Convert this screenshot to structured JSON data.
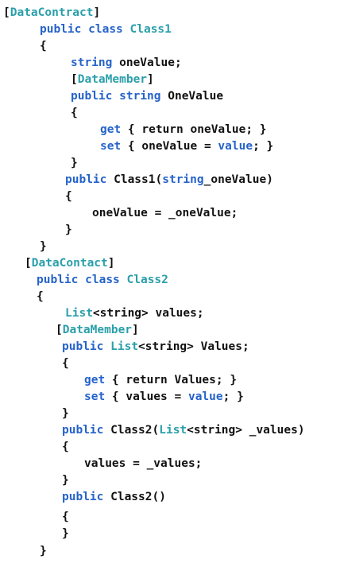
{
  "colors": {
    "keyword": "#2563c9",
    "type": "#2a9faa",
    "text": "#111111",
    "background": "#ffffff"
  },
  "lines": [
    {
      "tokens": [
        {
          "t": "[",
          "c": "plain"
        },
        {
          "t": "DataContract",
          "c": "attr"
        },
        {
          "t": "]",
          "c": "plain"
        }
      ]
    },
    {
      "tokens": [
        {
          "t": "public",
          "c": "kw"
        },
        {
          "t": " ",
          "c": "plain"
        },
        {
          "t": "class",
          "c": "kw"
        },
        {
          "t": " ",
          "c": "plain"
        },
        {
          "t": "Class1",
          "c": "type"
        }
      ]
    },
    {
      "tokens": [
        {
          "t": "{",
          "c": "plain"
        }
      ]
    },
    {
      "tokens": [
        {
          "t": "string",
          "c": "kw"
        },
        {
          "t": " oneValue;",
          "c": "plain"
        }
      ]
    },
    {
      "tokens": [
        {
          "t": "[",
          "c": "plain"
        },
        {
          "t": "DataMember",
          "c": "attr"
        },
        {
          "t": "]",
          "c": "plain"
        }
      ]
    },
    {
      "tokens": [
        {
          "t": "public",
          "c": "kw"
        },
        {
          "t": " ",
          "c": "plain"
        },
        {
          "t": "string",
          "c": "kw"
        },
        {
          "t": " OneValue",
          "c": "plain"
        }
      ]
    },
    {
      "tokens": [
        {
          "t": "{",
          "c": "plain"
        }
      ]
    },
    {
      "tokens": [
        {
          "t": "get",
          "c": "kw"
        },
        {
          "t": " { return oneValue; }",
          "c": "plain"
        }
      ]
    },
    {
      "tokens": [
        {
          "t": "set",
          "c": "kw"
        },
        {
          "t": " { oneValue = ",
          "c": "plain"
        },
        {
          "t": "value",
          "c": "kw"
        },
        {
          "t": "; }",
          "c": "plain"
        }
      ]
    },
    {
      "tokens": [
        {
          "t": "}",
          "c": "plain"
        }
      ]
    },
    {
      "tokens": [
        {
          "t": "public",
          "c": "kw"
        },
        {
          "t": " Class1(",
          "c": "plain"
        },
        {
          "t": "string",
          "c": "kw"
        },
        {
          "t": "_oneValue)",
          "c": "plain"
        }
      ]
    },
    {
      "tokens": [
        {
          "t": "{",
          "c": "plain"
        }
      ]
    },
    {
      "tokens": [
        {
          "t": "oneValue = _oneValue;",
          "c": "plain"
        }
      ]
    },
    {
      "tokens": [
        {
          "t": "}",
          "c": "plain"
        }
      ]
    },
    {
      "tokens": [
        {
          "t": "}",
          "c": "plain"
        }
      ]
    },
    {
      "tokens": [
        {
          "t": "[",
          "c": "plain"
        },
        {
          "t": "DataContact",
          "c": "attr"
        },
        {
          "t": "]",
          "c": "plain"
        }
      ]
    },
    {
      "tokens": [
        {
          "t": "public",
          "c": "kw"
        },
        {
          "t": " ",
          "c": "plain"
        },
        {
          "t": "class",
          "c": "kw"
        },
        {
          "t": " ",
          "c": "plain"
        },
        {
          "t": "Class2",
          "c": "type"
        }
      ]
    },
    {
      "tokens": [
        {
          "t": "{",
          "c": "plain"
        }
      ]
    },
    {
      "tokens": [
        {
          "t": "List",
          "c": "type"
        },
        {
          "t": "<string> values;",
          "c": "plain"
        }
      ]
    },
    {
      "tokens": [
        {
          "t": "[",
          "c": "plain"
        },
        {
          "t": "DataMember",
          "c": "attr"
        },
        {
          "t": "]",
          "c": "plain"
        }
      ]
    },
    {
      "tokens": [
        {
          "t": "public",
          "c": "kw"
        },
        {
          "t": " ",
          "c": "plain"
        },
        {
          "t": "List",
          "c": "type"
        },
        {
          "t": "<string> Values;",
          "c": "plain"
        }
      ]
    },
    {
      "tokens": [
        {
          "t": "{",
          "c": "plain"
        }
      ]
    },
    {
      "tokens": [
        {
          "t": "get",
          "c": "kw"
        },
        {
          "t": " { return Values; }",
          "c": "plain"
        }
      ]
    },
    {
      "tokens": [
        {
          "t": "set",
          "c": "kw"
        },
        {
          "t": " { values = ",
          "c": "plain"
        },
        {
          "t": "value",
          "c": "kw"
        },
        {
          "t": "; }",
          "c": "plain"
        }
      ]
    },
    {
      "tokens": [
        {
          "t": "}",
          "c": "plain"
        }
      ]
    },
    {
      "tokens": [
        {
          "t": "public",
          "c": "kw"
        },
        {
          "t": " Class2(",
          "c": "plain"
        },
        {
          "t": "List",
          "c": "type"
        },
        {
          "t": "<string> _values)",
          "c": "plain"
        }
      ]
    },
    {
      "tokens": [
        {
          "t": "{",
          "c": "plain"
        }
      ]
    },
    {
      "tokens": [
        {
          "t": "values = _values;",
          "c": "plain"
        }
      ]
    },
    {
      "tokens": [
        {
          "t": "}",
          "c": "plain"
        }
      ]
    },
    {
      "tokens": [
        {
          "t": "public",
          "c": "kw"
        },
        {
          "t": " Class2()",
          "c": "plain"
        }
      ]
    },
    {
      "tokens": [
        {
          "t": "{",
          "c": "plain"
        }
      ]
    },
    {
      "tokens": [
        {
          "t": "}",
          "c": "plain"
        }
      ]
    },
    {
      "tokens": [
        {
          "t": "}",
          "c": "plain"
        }
      ]
    }
  ]
}
